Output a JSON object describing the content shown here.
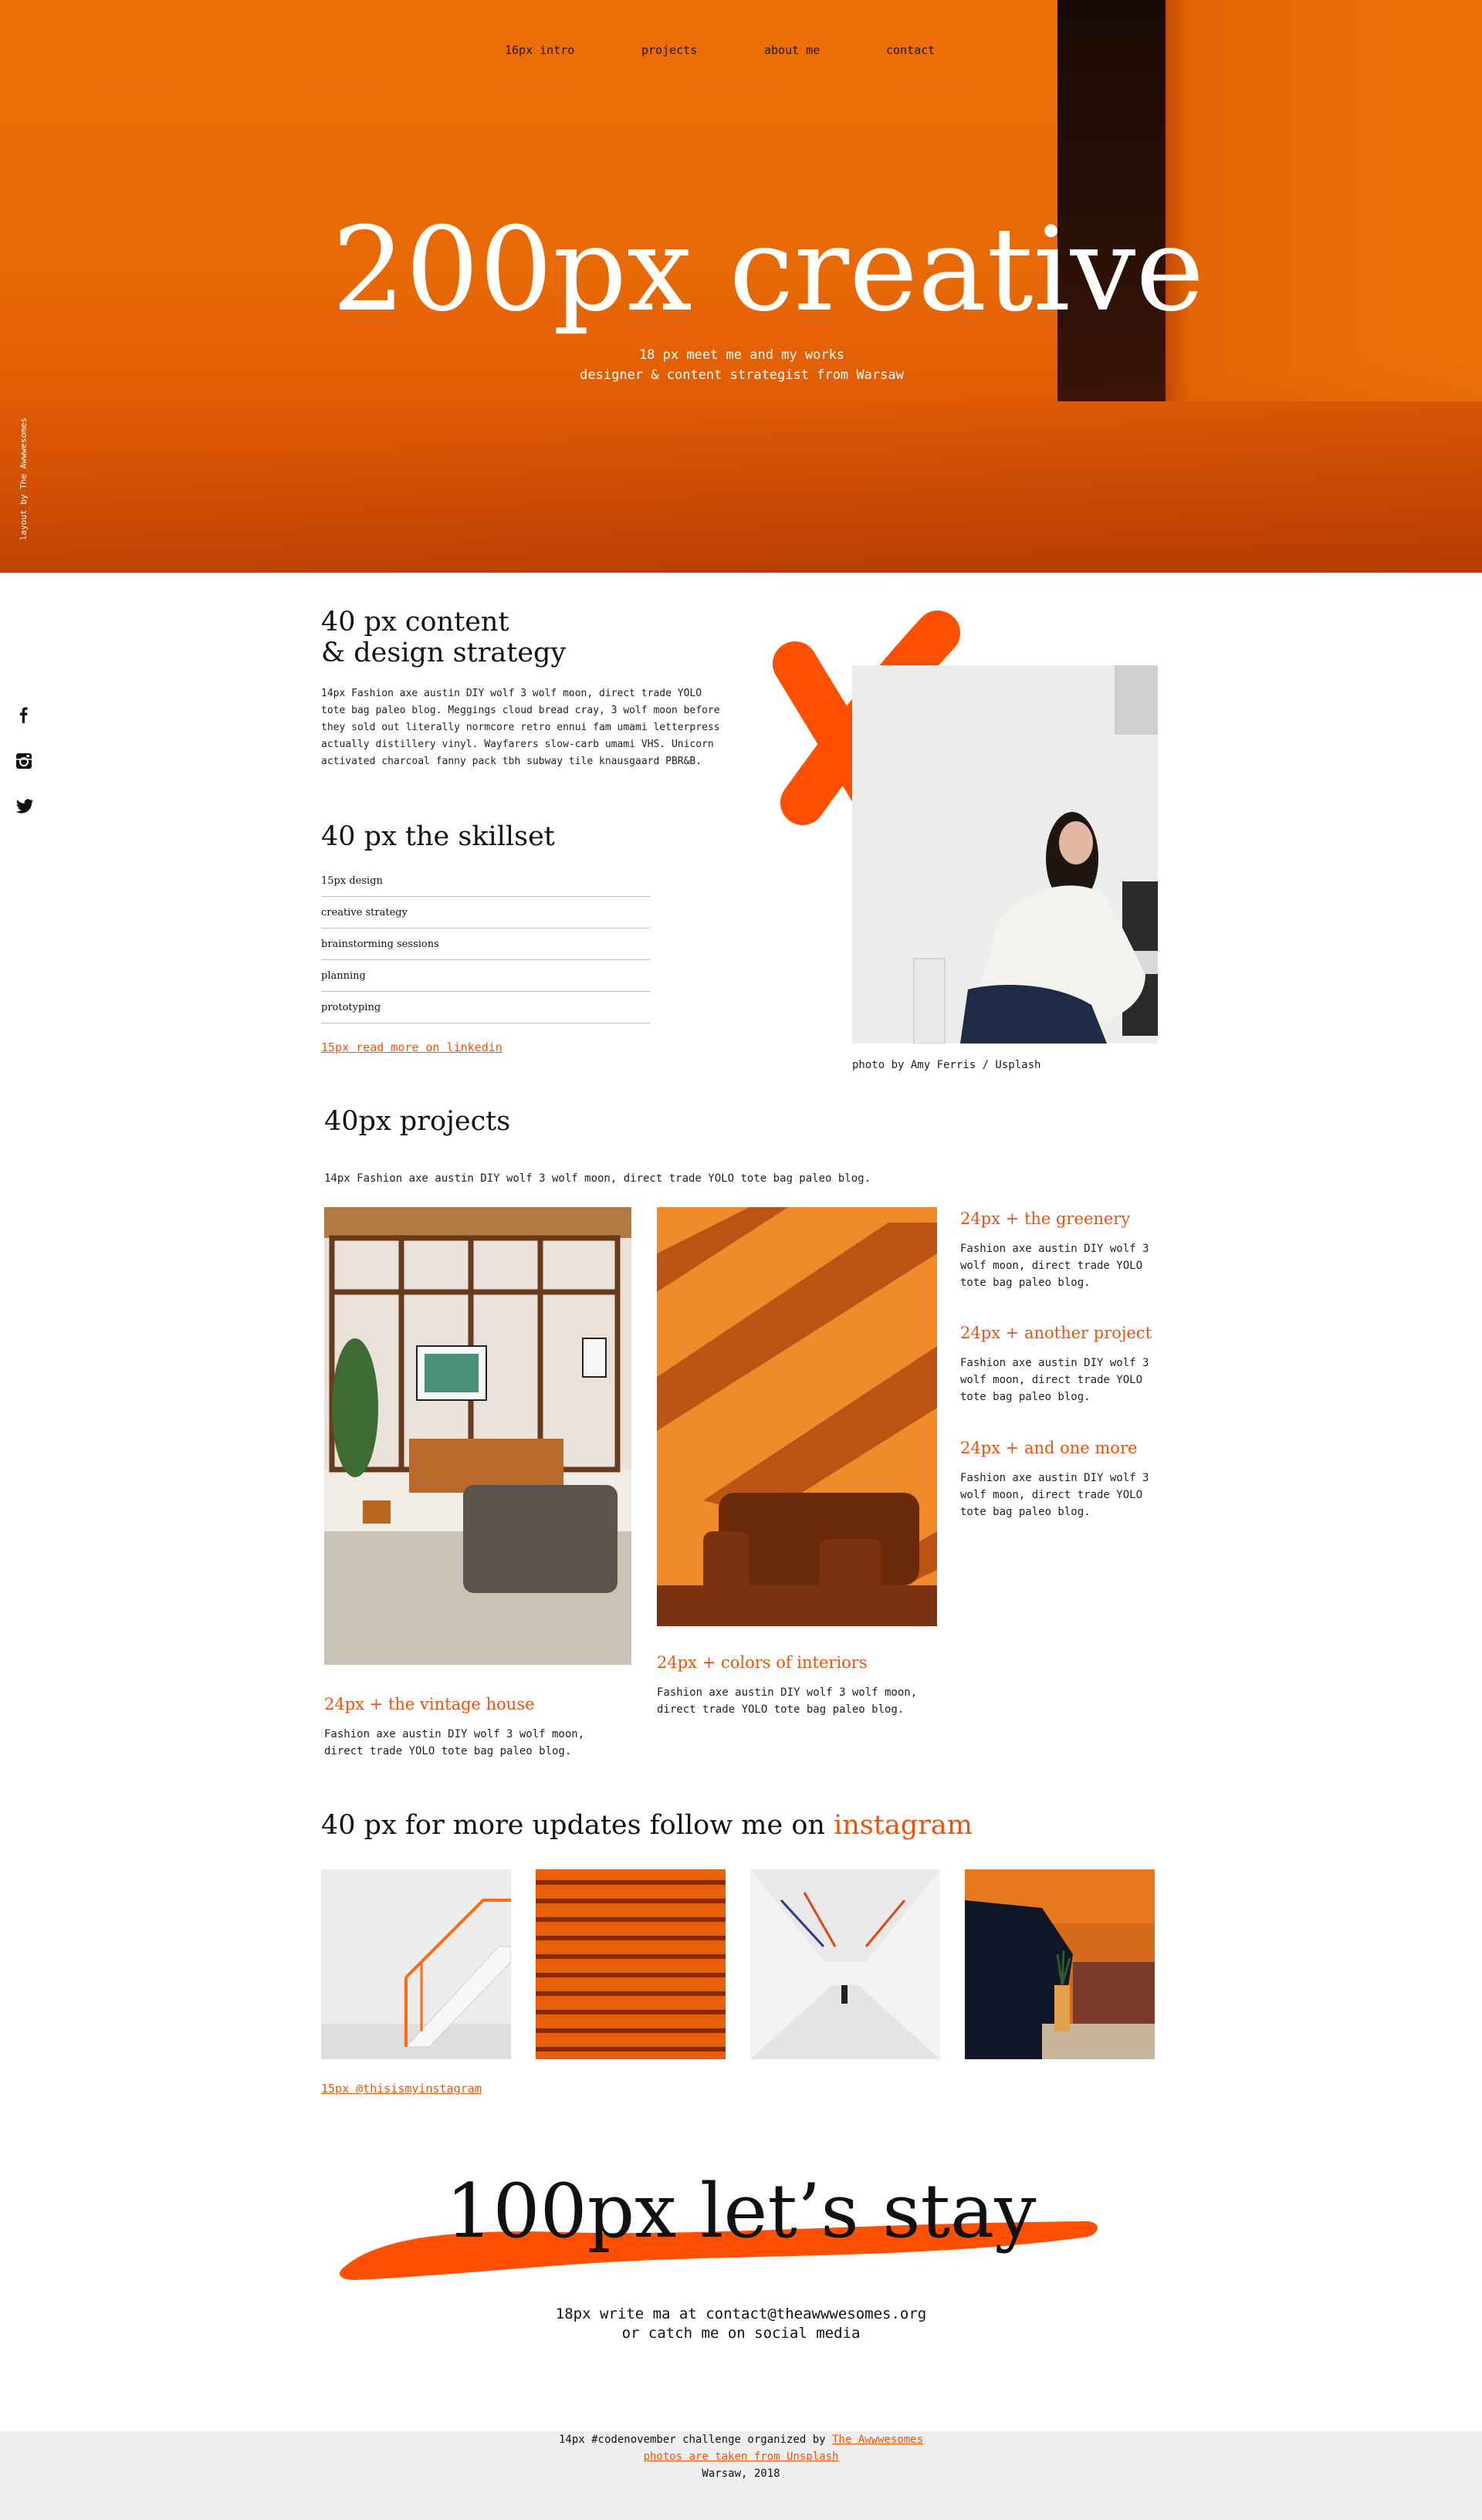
{
  "nav": {
    "items": [
      {
        "label": "16px intro"
      },
      {
        "label": "projects"
      },
      {
        "label": "about me"
      },
      {
        "label": "contact"
      }
    ]
  },
  "hero": {
    "title": "200px creative",
    "subtitle_line1": "18 px meet me and my works",
    "subtitle_line2": "designer & content strategist from Warsaw",
    "vertical_credit": "layout by The Awwwesomes"
  },
  "social": {
    "icons": [
      "facebook-icon",
      "instagram-icon",
      "twitter-icon"
    ]
  },
  "about": {
    "heading_line1": "40 px content",
    "heading_line2": "& design strategy",
    "paragraph": "14px Fashion axe austin DIY wolf 3 wolf moon, direct trade YOLO tote bag paleo blog. Meggings cloud bread cray, 3 wolf moon before they sold out literally normcore retro ennui fam umami letterpress actually distillery vinyl. Wayfarers slow-carb umami VHS. Unicorn activated charcoal fanny pack tbh subway tile knausgaard PBR&B.",
    "skills_heading": "40 px the skillset",
    "skills": [
      "15px design",
      "creative strategy",
      "brainstorming sessions",
      "planning",
      "prototyping"
    ],
    "linkedin_link": "15px read more on linkedin",
    "photo_caption": "photo by Amy Ferris / Usplash",
    "accent_color": "#ff4f00"
  },
  "projects": {
    "heading": "40px projects",
    "intro": "14px Fashion axe austin DIY wolf 3 wolf moon, direct trade YOLO tote bag paleo blog.",
    "items": [
      {
        "title": "24px + the vintage house",
        "text_line1": "Fashion axe austin DIY wolf 3 wolf moon,",
        "text_line2": "direct trade YOLO tote bag paleo blog."
      },
      {
        "title": "24px + colors of interiors",
        "text_line1": "Fashion axe austin DIY wolf 3 wolf moon,",
        "text_line2": "direct trade YOLO tote bag paleo blog."
      },
      {
        "title": "24px + the greenery",
        "text_line1": "Fashion axe austin DIY wolf 3",
        "text_line2": "wolf moon, direct trade YOLO",
        "text_line3": "tote bag paleo blog."
      },
      {
        "title": "24px + another project",
        "text_line1": "Fashion axe austin DIY wolf 3",
        "text_line2": "wolf moon, direct trade YOLO",
        "text_line3": "tote bag paleo blog."
      },
      {
        "title": "24px + and one more",
        "text_line1": "Fashion axe austin DIY wolf 3",
        "text_line2": "wolf moon, direct trade YOLO",
        "text_line3": "tote bag paleo blog."
      }
    ]
  },
  "instagram": {
    "heading_prefix": "40 px for more updates follow me on ",
    "heading_accent": "instagram",
    "handle_link": "15px @thisismyinstagram"
  },
  "contact": {
    "big_title": "100px let’s stay",
    "line1": "18px write ma at contact@theawwwesomes.org",
    "line2": "or catch me on social media"
  },
  "footer": {
    "line1_prefix": "14px #codenovember challenge organized by ",
    "line1_link": "The Awwwesomes",
    "line2_link": "photos are taken from Unsplash",
    "line3": "Warsaw, 2018"
  }
}
